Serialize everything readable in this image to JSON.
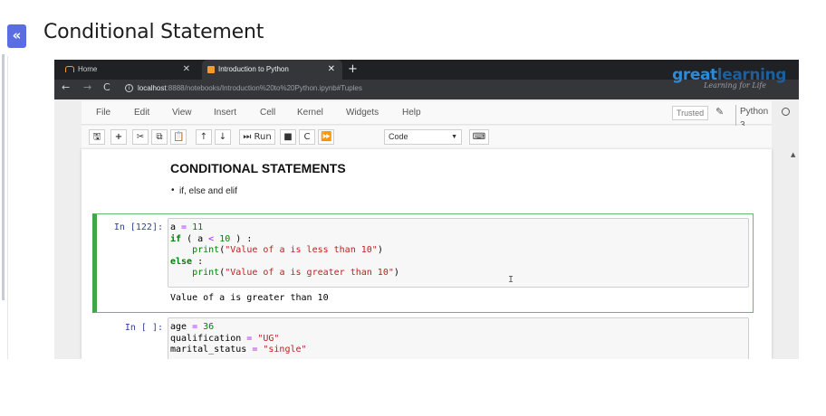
{
  "page": {
    "title": "Conditional Statement",
    "collapse_icon": "«"
  },
  "browser": {
    "tabs": [
      {
        "label": "Home"
      },
      {
        "label": "Introduction to Python"
      }
    ],
    "new_tab_label": "+",
    "url_host": "localhost",
    "url_rest": ":8888/notebooks/Introduction%20to%20Python.ipynb#Tuples"
  },
  "watermark": {
    "brand_a": "great",
    "brand_b": "learning",
    "tagline": "Learning for Life"
  },
  "notebook": {
    "menu": [
      "File",
      "Edit",
      "View",
      "Insert",
      "Cell",
      "Kernel",
      "Widgets",
      "Help"
    ],
    "trusted_label": "Trusted",
    "kernel_name": "Python 3",
    "toolbar": {
      "run_label": "Run",
      "cell_type": "Code"
    },
    "markdown": {
      "heading": "CONDITIONAL STATEMENTS",
      "bullet": "if, else and elif"
    },
    "cells": [
      {
        "prompt": "In [122]:",
        "code": [
          "a = 11",
          "if ( a < 10 ) :",
          "    print(\"Value of a is less than 10\")",
          "else :",
          "    print(\"Value of a is greater than 10\")"
        ],
        "output": "Value of a is greater than 10"
      },
      {
        "prompt": "In [ ]:",
        "code": [
          "age = 36",
          "qualification = \"UG\"",
          "marital_status = \"single\""
        ]
      }
    ]
  },
  "colors": {
    "accent": "#5b6ee1",
    "selected_cell": "#42a54a",
    "prompt": "#303f9f"
  }
}
